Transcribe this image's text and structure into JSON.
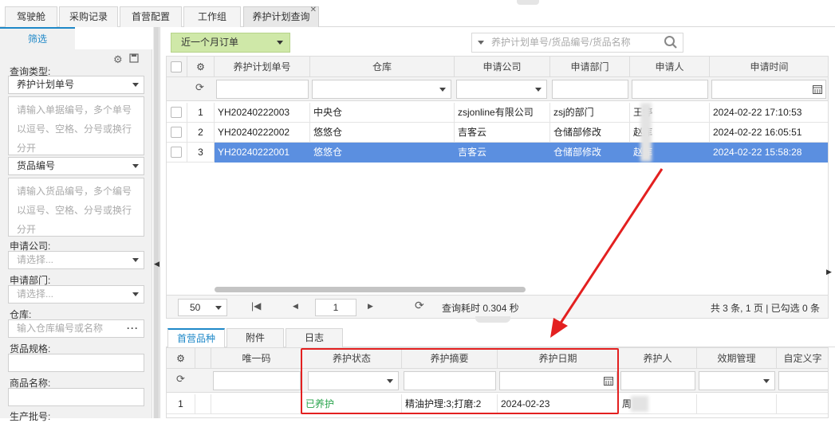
{
  "tabs": [
    {
      "label": "驾驶舱"
    },
    {
      "label": "采购记录"
    },
    {
      "label": "首营配置"
    },
    {
      "label": "工作组"
    },
    {
      "label": "养护计划查询",
      "closable": true
    }
  ],
  "left": {
    "tab_label": "筛选",
    "query_type_label": "查询类型:",
    "query_type_value": "养护计划单号",
    "plan_no_placeholder": "请输入单据编号，多个单号以逗号、空格、分号或换行分开",
    "goods_type_value": "货品编号",
    "goods_no_placeholder": "请输入货品编号，多个编号以逗号、空格、分号或换行分开",
    "company_label": "申请公司:",
    "company_placeholder": "请选择...",
    "dept_label": "申请部门:",
    "dept_placeholder": "请选择...",
    "warehouse_label": "仓库:",
    "warehouse_placeholder": "输入仓库编号或名称",
    "spec_label": "货品规格:",
    "name_label": "商品名称:",
    "batch_label": "生产批号:"
  },
  "main": {
    "date_filter": "近一个月订单",
    "search_placeholder": "养护计划单号/货品编号/货品名称",
    "columns": [
      "养护计划单号",
      "仓库",
      "申请公司",
      "申请部门",
      "申请人",
      "申请时间"
    ],
    "rows": [
      {
        "idx": "1",
        "plan_no": "YH20240222003",
        "warehouse": "中央仓",
        "company": "zsjonline有限公司",
        "dept": "zsj的部门",
        "applicant": "王婷",
        "time": "2024-02-22 17:10:53"
      },
      {
        "idx": "2",
        "plan_no": "YH20240222002",
        "warehouse": "悠悠仓",
        "company": "吉客云",
        "dept": "仓储部修改",
        "applicant": "赵库",
        "time": "2024-02-22 16:05:51"
      },
      {
        "idx": "3",
        "plan_no": "YH20240222001",
        "warehouse": "悠悠仓",
        "company": "吉客云",
        "dept": "仓储部修改",
        "applicant": "赵库",
        "time": "2024-02-22 15:58:28",
        "selected": true
      }
    ],
    "pager": {
      "page_size": "50",
      "page": "1",
      "elapsed": "查询耗时 0.304 秒",
      "summary": "共 3 条, 1 页 | 已勾选 0 条"
    }
  },
  "bottom": {
    "tabs": [
      "首营品种",
      "附件",
      "日志"
    ],
    "columns": [
      "唯一码",
      "养护状态",
      "养护摘要",
      "养护日期",
      "养护人",
      "效期管理",
      "自定义字"
    ],
    "rows": [
      {
        "idx": "1",
        "code": "",
        "status": "已养护",
        "summary": "精油护理:3;打磨:2",
        "date": "2024-02-23",
        "person": "周"
      }
    ]
  },
  "colors": {
    "selected_row": "#5b8fe0",
    "status_green": "#2aa44d",
    "highlight": "#e32020",
    "filter_button": "#cfe8a8",
    "accent": "#1e88c8"
  }
}
